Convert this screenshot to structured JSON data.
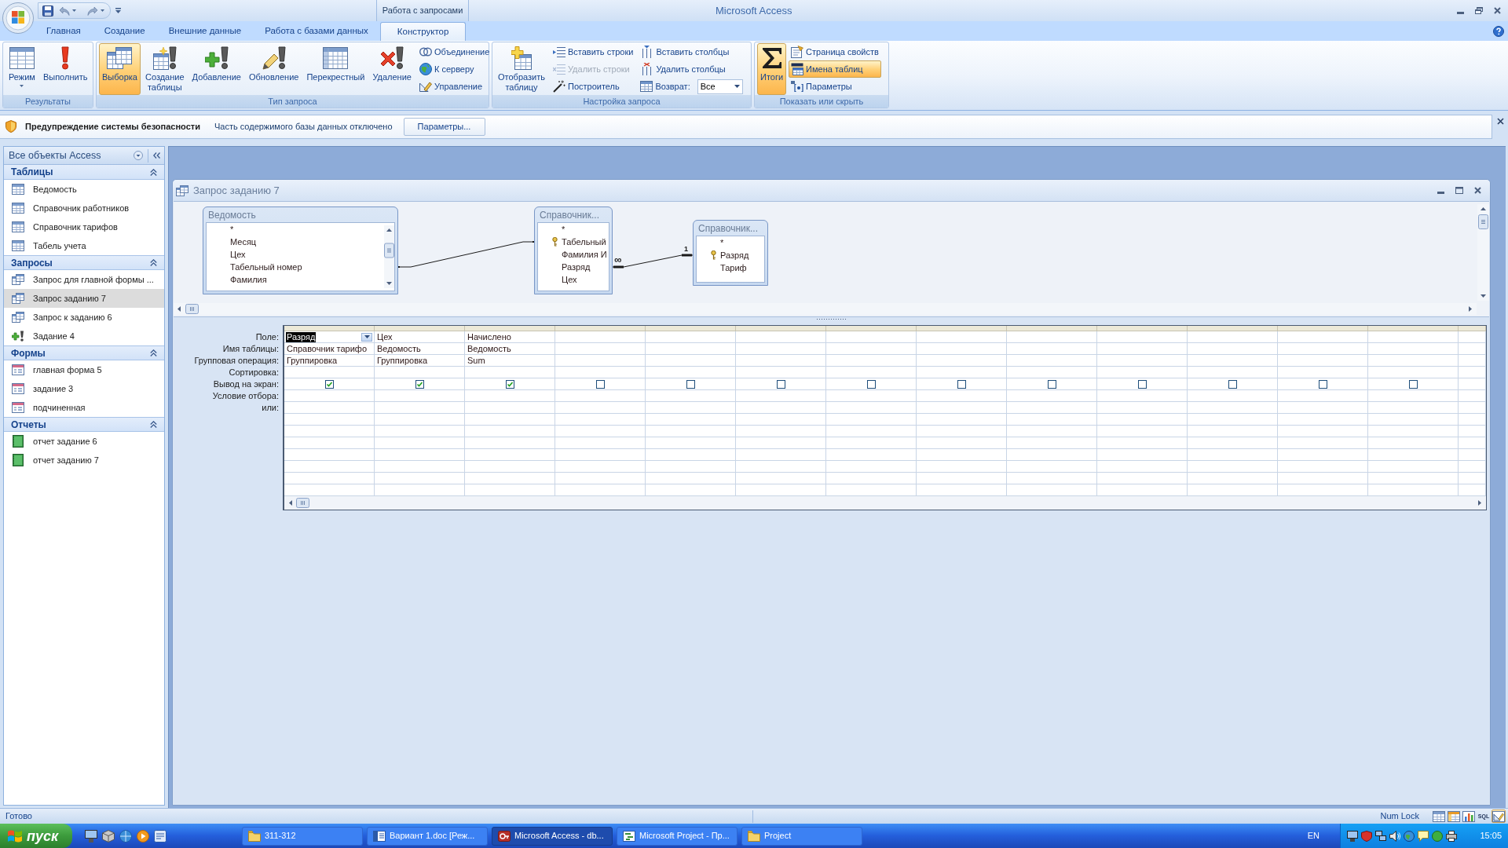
{
  "title_bar": {
    "title": "Microsoft Access",
    "context_label": "Работа с запросами"
  },
  "ribbon_tabs": [
    {
      "label": "Главная",
      "selected": false
    },
    {
      "label": "Создание",
      "selected": false
    },
    {
      "label": "Внешние данные",
      "selected": false
    },
    {
      "label": "Работа с базами данных",
      "selected": false
    },
    {
      "label": "Конструктор",
      "selected": true
    }
  ],
  "ribbon_groups": [
    {
      "title": "Результаты",
      "buttons": [
        {
          "label": "Режим",
          "kind": "large",
          "menu": true
        },
        {
          "label": "Выполнить",
          "kind": "large"
        }
      ]
    },
    {
      "title": "Тип запроса",
      "buttons": [
        {
          "label": "Выборка",
          "kind": "large",
          "selected": true
        },
        {
          "label": "Создание таблицы",
          "kind": "large",
          "selected": false
        },
        {
          "label": "Добавление",
          "kind": "large",
          "selected": false
        },
        {
          "label": "Обновление",
          "kind": "large",
          "selected": false
        },
        {
          "label": "Перекрестный",
          "kind": "large",
          "selected": false
        },
        {
          "label": "Удаление",
          "kind": "large",
          "selected": false
        },
        {
          "label": "Объединение",
          "kind": "small",
          "selected": false
        },
        {
          "label": "К серверу",
          "kind": "small",
          "selected": false
        },
        {
          "label": "Управление",
          "kind": "small",
          "selected": false
        }
      ]
    },
    {
      "title": "Настройка запроса",
      "buttons": [
        {
          "label": "Отобразить таблицу",
          "kind": "large",
          "disabled": false
        },
        {
          "label": "Вставить строки",
          "kind": "small",
          "disabled": false
        },
        {
          "label": "Удалить строки",
          "kind": "small",
          "disabled": true
        },
        {
          "label": "Построитель",
          "kind": "small",
          "disabled": false
        },
        {
          "label": "Вставить столбцы",
          "kind": "small",
          "disabled": false
        },
        {
          "label": "Удалить столбцы",
          "kind": "small",
          "disabled": false
        },
        {
          "label": "Возврат:",
          "kind": "dropdown",
          "value": "Все"
        }
      ]
    },
    {
      "title": "Показать или скрыть",
      "buttons": [
        {
          "label": "Итоги",
          "kind": "large",
          "selected": true
        },
        {
          "label": "Страница свойств",
          "kind": "small",
          "selected": false
        },
        {
          "label": "Имена таблиц",
          "kind": "small",
          "selected": true
        },
        {
          "label": "Параметры",
          "kind": "small",
          "selected": false
        }
      ]
    }
  ],
  "message_bar": {
    "title": "Предупреждение системы безопасности",
    "text": "Часть содержимого базы данных отключено",
    "button": "Параметры..."
  },
  "navigation": {
    "title": "Все объекты Access",
    "groups": [
      {
        "title": "Таблицы",
        "expanded": true,
        "items": [
          {
            "label": "Ведомость",
            "kind": "table",
            "selected": false
          },
          {
            "label": "Справочник работников",
            "kind": "table",
            "selected": false
          },
          {
            "label": "Справочник тарифов",
            "kind": "table",
            "selected": false
          },
          {
            "label": "Табель учета",
            "kind": "table",
            "selected": false
          }
        ]
      },
      {
        "title": "Запросы",
        "expanded": true,
        "items": [
          {
            "label": "Запрос для главной формы ...",
            "kind": "query",
            "selected": false
          },
          {
            "label": "Запрос заданию 7",
            "kind": "query",
            "selected": true
          },
          {
            "label": "Запрос к заданию 6",
            "kind": "query",
            "selected": false
          },
          {
            "label": "Задание 4",
            "kind": "append",
            "selected": false
          }
        ]
      },
      {
        "title": "Формы",
        "expanded": true,
        "items": [
          {
            "label": "главная форма 5",
            "kind": "form",
            "selected": false
          },
          {
            "label": "задание 3",
            "kind": "form",
            "selected": false
          },
          {
            "label": "подчиненная",
            "kind": "form",
            "selected": false
          }
        ]
      },
      {
        "title": "Отчеты",
        "expanded": true,
        "items": [
          {
            "label": "отчет задание 6",
            "kind": "report",
            "selected": false
          },
          {
            "label": "отчет заданию 7",
            "kind": "report",
            "selected": false
          }
        ]
      }
    ]
  },
  "query_window": {
    "title": "Запрос заданию 7",
    "tables": [
      {
        "title": "Ведомость",
        "fields": [
          {
            "label": "*",
            "key": false
          },
          {
            "label": "Месяц",
            "key": false
          },
          {
            "label": "Цех",
            "key": false
          },
          {
            "label": "Табельный номер",
            "key": false
          },
          {
            "label": "Фамилия",
            "key": false
          }
        ]
      },
      {
        "title": "Справочник...",
        "fields": [
          {
            "label": "*",
            "key": false
          },
          {
            "label": "Табельный",
            "key": true
          },
          {
            "label": "Фамилия И",
            "key": false
          },
          {
            "label": "Разряд",
            "key": false
          },
          {
            "label": "Цех",
            "key": false
          }
        ]
      },
      {
        "title": "Справочник...",
        "fields": [
          {
            "label": "*",
            "key": false
          },
          {
            "label": "Разряд",
            "key": true
          },
          {
            "label": "Тариф",
            "key": false
          }
        ]
      }
    ],
    "joins": [
      {
        "kind": "plain"
      },
      {
        "kind": "one_to_many",
        "many_label": "∞",
        "one_label": "1"
      }
    ],
    "grid": {
      "row_labels": [
        "Поле:",
        "Имя таблицы:",
        "Групповая операция:",
        "Сортировка:",
        "Вывод на экран:",
        "Условие отбора:",
        "или:"
      ],
      "columns": [
        {
          "field": "Разряд",
          "table": "Справочник тарифо",
          "total": "Группировка",
          "checked": true,
          "selected": true
        },
        {
          "field": "Цех",
          "table": "Ведомость",
          "total": "Группировка",
          "checked": true,
          "selected": false
        },
        {
          "field": "Начислено",
          "table": "Ведомость",
          "total": "Sum",
          "checked": true,
          "selected": false
        },
        {
          "checked": false,
          "selected": false
        },
        {
          "checked": false,
          "selected": false
        },
        {
          "checked": false,
          "selected": false
        },
        {
          "checked": false,
          "selected": false
        },
        {
          "checked": false,
          "selected": false
        },
        {
          "checked": false,
          "selected": false
        },
        {
          "checked": false,
          "selected": false
        },
        {
          "checked": false,
          "selected": false
        },
        {
          "checked": false,
          "selected": false
        },
        {
          "checked": false,
          "selected": false
        }
      ]
    }
  },
  "status_bar": {
    "text": "Готово",
    "indicator": "Num Lock",
    "views": [
      {
        "kind": "datasheet",
        "selected": false
      },
      {
        "kind": "pivot_table",
        "selected": false
      },
      {
        "kind": "pivot_chart",
        "selected": false
      },
      {
        "kind": "sql",
        "label": "SQL",
        "selected": false
      },
      {
        "kind": "design",
        "selected": true
      }
    ]
  },
  "taskbar": {
    "start_label": "пуск",
    "tasks": [
      {
        "label": "311-312",
        "selected": false
      },
      {
        "label": "Вариант 1.doc [Реж...",
        "selected": false
      },
      {
        "label": "Microsoft Access - db...",
        "selected": true
      },
      {
        "label": "Microsoft Project - Пр...",
        "selected": false
      },
      {
        "label": "Project",
        "selected": false
      }
    ],
    "language": "EN",
    "clock": "15:05"
  }
}
